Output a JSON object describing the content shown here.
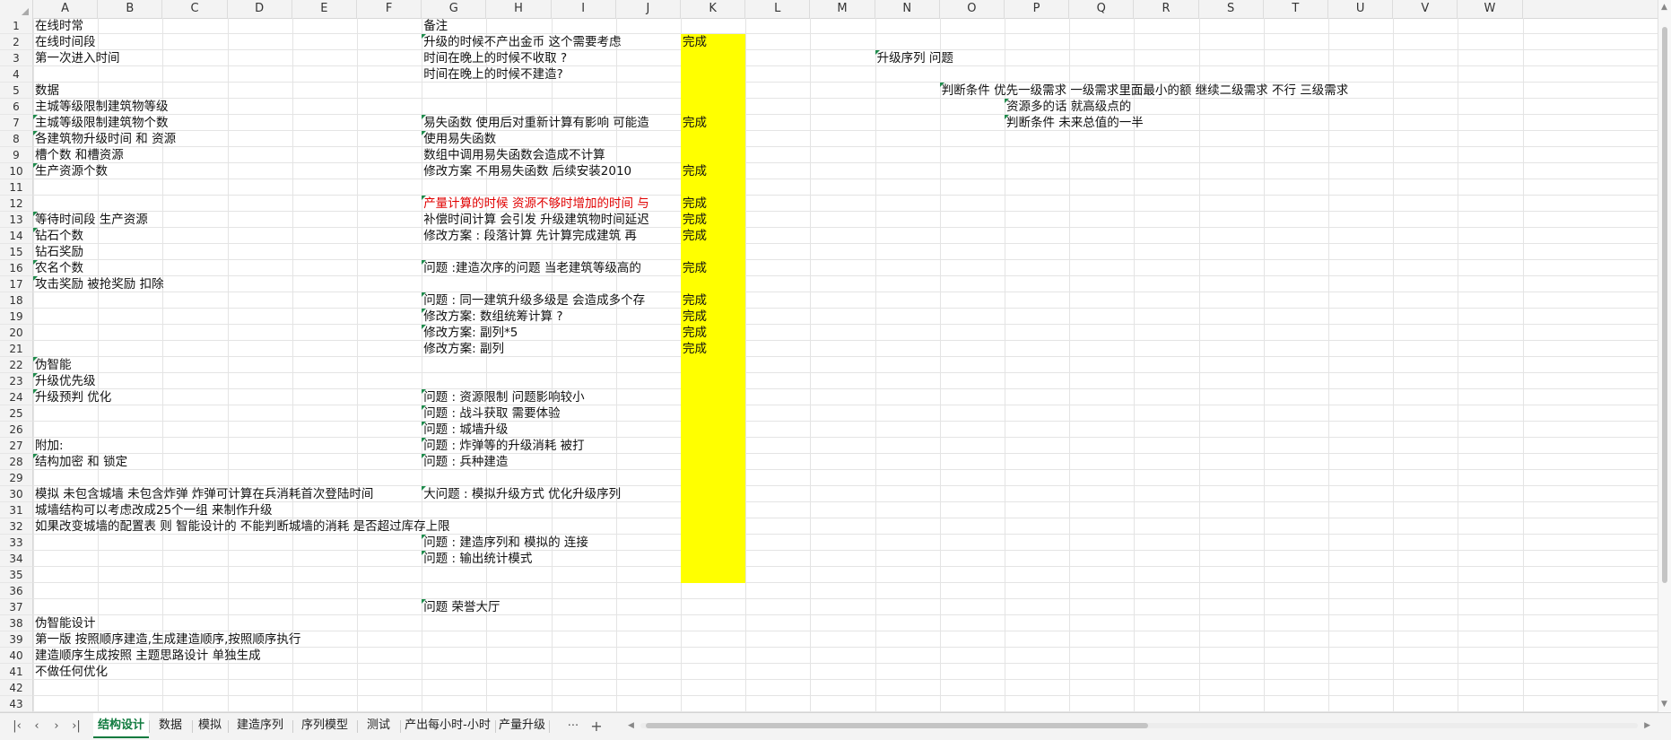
{
  "columns": [
    "A",
    "B",
    "C",
    "D",
    "E",
    "F",
    "G",
    "H",
    "I",
    "J",
    "K",
    "L",
    "M",
    "N",
    "O",
    "P",
    "Q",
    "R",
    "S",
    "T",
    "U",
    "V",
    "W"
  ],
  "rows": [
    "1",
    "2",
    "3",
    "4",
    "5",
    "6",
    "7",
    "8",
    "9",
    "10",
    "11",
    "12",
    "13",
    "14",
    "15",
    "16",
    "17",
    "18",
    "19",
    "20",
    "21",
    "22",
    "23",
    "24",
    "25",
    "26",
    "27",
    "28",
    "29",
    "30",
    "31",
    "32",
    "33",
    "34",
    "35",
    "36",
    "37",
    "38",
    "39",
    "40",
    "41",
    "42",
    "43"
  ],
  "cells": {
    "A1": "在线时常",
    "A2": "在线时间段",
    "A3": "第一次进入时间",
    "A5": "数据",
    "A6": "主城等级限制建筑物等级",
    "A7": "主城等级限制建筑物个数",
    "A8": "各建筑物升级时间 和 资源",
    "A9": "槽个数 和槽资源",
    "A10": "生产资源个数",
    "A13": "等待时间段 生产资源",
    "A14": "钻石个数",
    "A15": "钻石奖励",
    "A16": "农名个数",
    "A17": "攻击奖励  被抢奖励 扣除",
    "A22": "伪智能",
    "A23": "升级优先级",
    "A24": "升级预判  优化",
    "A27": "附加:",
    "A28": "结构加密 和 锁定",
    "A30": "模拟 未包含城墙 未包含炸弹 炸弹可计算在兵消耗首次登陆时间",
    "A31": "城墙结构可以考虑改成25个一组  来制作升级",
    "A32": "如果改变城墙的配置表 则 智能设计的 不能判断城墙的消耗 是否超过库存上限",
    "A38": "伪智能设计",
    "A39": "第一版 按照顺序建造,生成建造顺序,按照顺序执行",
    "A40": "建造顺序生成按照 主题思路设计 单独生成",
    "A41": "不做任何优化",
    "G1": "备注",
    "G2": "升级的时候不产出金币     这个需要考虑",
    "G3": "时间在晚上的时候不收取  ?",
    "G4": "时间在晚上的时候不建造?",
    "G7": "易失函数 使用后对重新计算有影响  可能造",
    "G8": "使用易失函数",
    "G9": "数组中调用易失函数会造成不计算",
    "G10": "修改方案  不用易失函数  后续安装2010",
    "G12": "产量计算的时候 资源不够时增加的时间 与",
    "G13": "补偿时间计算 会引发 升级建筑物时间延迟",
    "G14": "修改方案 :   段落计算 先计算完成建筑 再",
    "G16": "问题 :建造次序的问题 当老建筑等级高的",
    "G18": "问题 :  同一建筑升级多级是 会造成多个存",
    "G19": "修改方案:   数组统筹计算 ?",
    "G20": "修改方案:   副列*5",
    "G21": "修改方案:  副列",
    "G24": "问题 :   资源限制     问题影响较小",
    "G25": "问题  :    战斗获取     需要体验",
    "G26": "问题  :   城墙升级",
    "G27": "问题 :   炸弹等的升级消耗  被打",
    "G28": "问题 :   兵种建造",
    "G30": "大问题   :     模拟升级方式   优化升级序列",
    "G33": "问题  :   建造序列和 模拟的 连接",
    "G34": "问题  :   输出统计模式",
    "G37": "问题   荣誉大厅",
    "K2": "完成",
    "K7": "完成",
    "K10": "完成",
    "K12": "完成",
    "K13": "完成",
    "K14": "完成",
    "K16": "完成",
    "K18": "完成",
    "K19": "完成",
    "K20": "完成",
    "K21": "完成",
    "N3": "升级序列   问题",
    "O5": "判断条件 优先一级需求  一级需求里面最小的额   继续二级需求    不行 三级需求",
    "P6": "资源多的话 就高级点的",
    "P7": "判断条件 未来总值的一半"
  },
  "sheet_tabs": [
    "结构设计",
    "数据",
    "模拟",
    "建造序列",
    "序列模型",
    "测试",
    "产出每小时-小时",
    "产量升级"
  ],
  "active_tab": "结构设计",
  "more_tabs": "···",
  "add_tab": "+",
  "colors": {
    "fill_highlight": "#ffff00",
    "red_text": "#e00000",
    "active_tab": "#0f7a3e"
  }
}
